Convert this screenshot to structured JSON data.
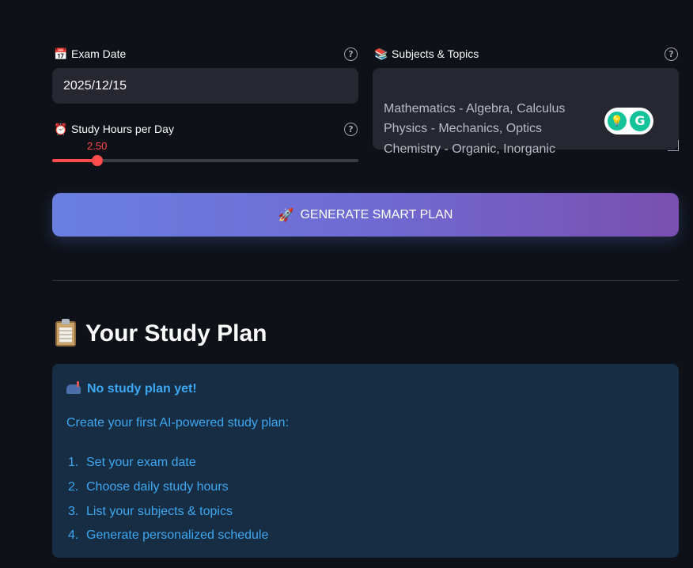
{
  "exam_date": {
    "label": "Exam Date",
    "icon": "calendar-icon",
    "value": "2025/12/15"
  },
  "study_hours": {
    "label": "Study Hours per Day",
    "icon": "alarm-clock-icon",
    "value": "2.50",
    "fraction": 0.148
  },
  "subjects": {
    "label": "Subjects & Topics",
    "icon": "books-icon",
    "value": "Mathematics - Algebra, Calculus\nPhysics - Mechanics, Optics\nChemistry - Organic, Inorganic"
  },
  "generate_button": {
    "label": "GENERATE SMART PLAN",
    "icon": "🚀"
  },
  "study_plan": {
    "title": "Your Study Plan",
    "icon": "clipboard-icon",
    "info": {
      "heading": "No study plan yet!",
      "intro": "Create your first AI-powered study plan:",
      "steps": [
        {
          "num": "1.",
          "text": "Set your exam date"
        },
        {
          "num": "2.",
          "text": "Choose daily study hours"
        },
        {
          "num": "3.",
          "text": "List your subjects & topics"
        },
        {
          "num": "4.",
          "text": "Generate personalized schedule"
        }
      ]
    }
  },
  "colors": {
    "background": "#0e1117",
    "input_bg": "#262730",
    "slider_accent": "#ff4b4b",
    "button_gradient_start": "#667eea",
    "button_gradient_end": "#764ba2",
    "info_bg": "#172d43",
    "info_text": "#3ea7f2"
  }
}
